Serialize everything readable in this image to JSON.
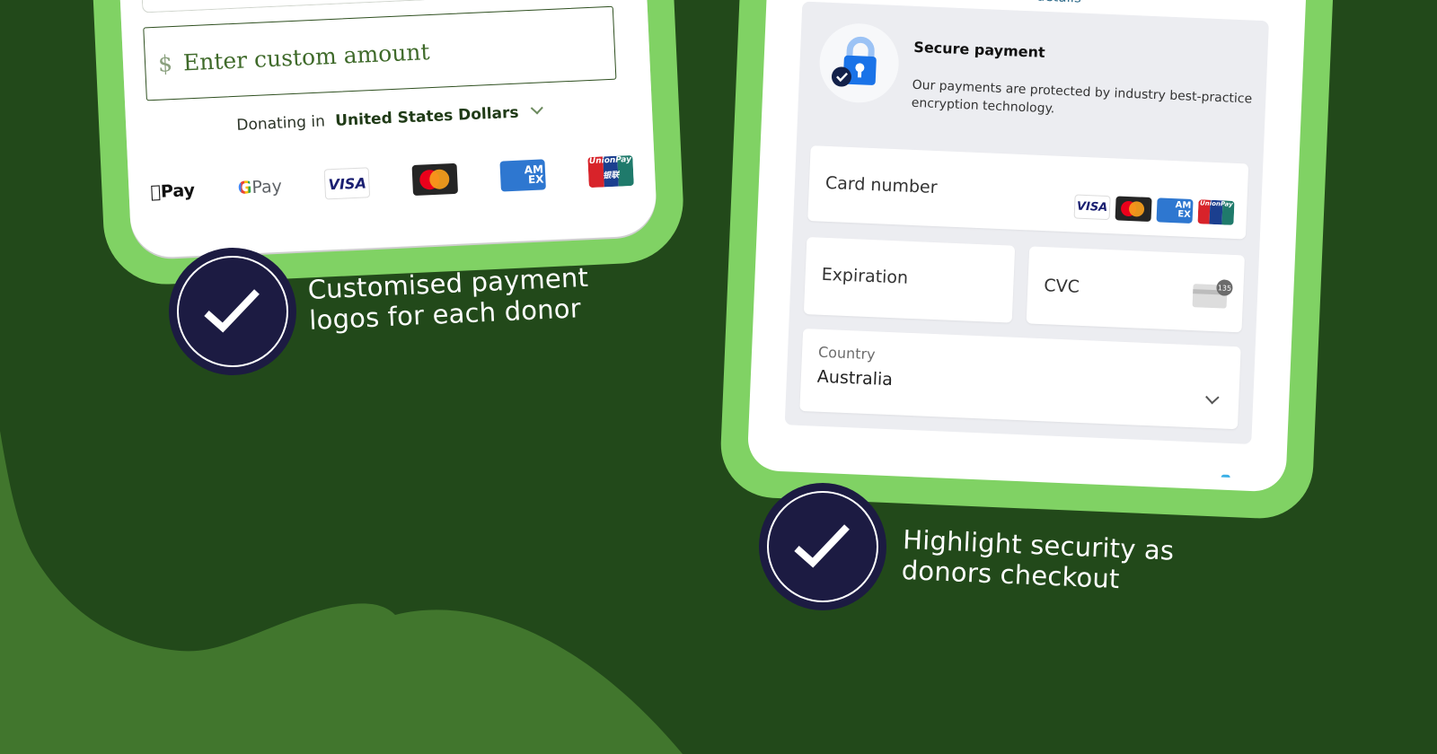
{
  "colors": {
    "background": "#22491a",
    "wave": "#41762d",
    "phone_frame": "#80d264",
    "badge": "#1c1b42",
    "panel": "#ecedf1"
  },
  "left_phone": {
    "amount_field": {
      "currency_symbol": "$",
      "placeholder": "Enter custom amount"
    },
    "donating": {
      "prefix": "Donating in",
      "currency": "United States Dollars",
      "icon": "chevron-down-icon"
    },
    "payment_logos": [
      {
        "name": "apple-pay",
        "label": "Pay",
        "icon": "apple-icon"
      },
      {
        "name": "google-pay",
        "g": "G",
        "label": "Pay"
      },
      {
        "name": "visa",
        "label": "VISA"
      },
      {
        "name": "mastercard",
        "label": ""
      },
      {
        "name": "amex",
        "label_top": "AM",
        "label_bottom": "EX"
      },
      {
        "name": "unionpay",
        "label_top": "UnionPay",
        "label_bottom": "银联"
      }
    ]
  },
  "right_phone": {
    "cut_link_text": "details",
    "secure": {
      "icon": "lock-check-icon",
      "title": "Secure payment",
      "description": "Our payments are protected by industry best-practice encryption technology."
    },
    "fields": {
      "card_number": {
        "label": "Card number",
        "brands": [
          "VISA",
          "Mastercard",
          "AMEX",
          "UnionPay"
        ]
      },
      "expiration": {
        "label": "Expiration"
      },
      "cvc": {
        "label": "CVC",
        "icon_number": "135"
      },
      "country": {
        "label": "Country",
        "value": "Australia"
      }
    }
  },
  "features": [
    {
      "icon": "checkmark-icon",
      "line1": "Customised payment",
      "line2": "logos for each donor"
    },
    {
      "icon": "checkmark-icon",
      "line1": "Highlight security as",
      "line2": "donors checkout"
    }
  ]
}
